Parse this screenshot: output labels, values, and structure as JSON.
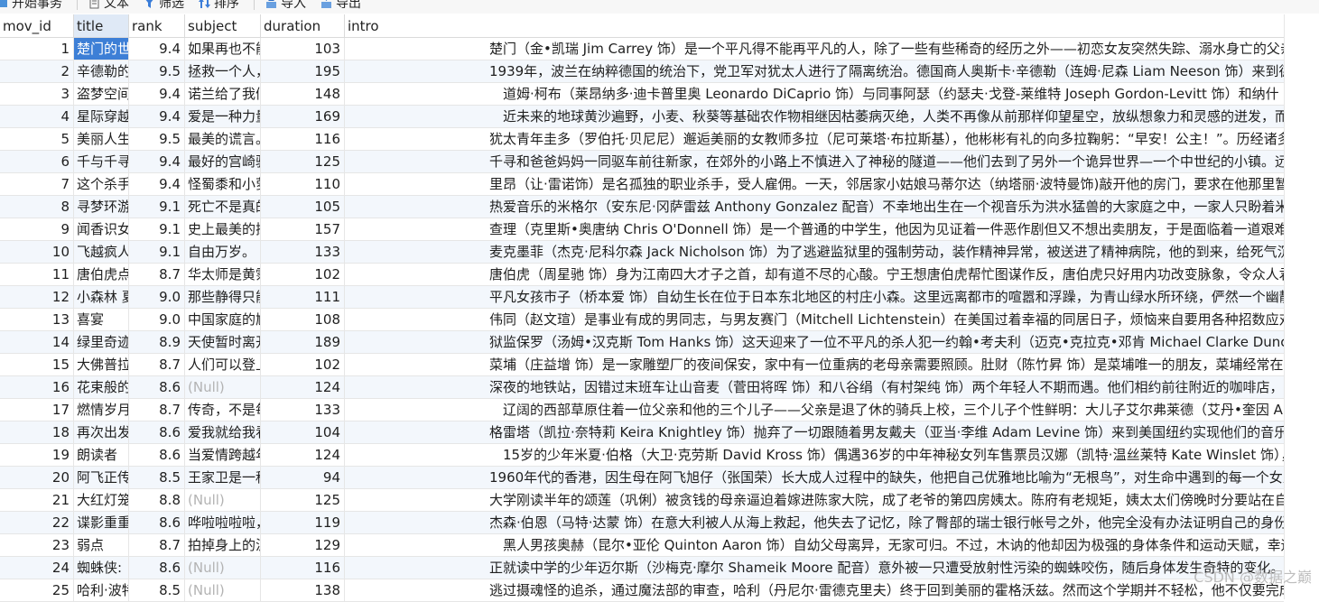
{
  "toolbar": {
    "items": [
      "开始事务",
      "文本",
      "筛选",
      "排序",
      "导入",
      "导出"
    ]
  },
  "columns": [
    "mov_id",
    "title",
    "rank",
    "subject",
    "duration",
    "intro"
  ],
  "null_text": "(Null)",
  "watermark": "CSDN @数据之巅",
  "rows": [
    {
      "id": "1",
      "title": "楚门的世",
      "rank": "9.4",
      "subject": "如果再也不能",
      "duration": "103",
      "intro": "楚门（金•凯瑞 Jim Carrey 饰）是一个平凡得不能再平凡的人，除了一些有些稀奇的经历之外——初恋女友突然失踪、溺水身亡的父亲"
    },
    {
      "id": "2",
      "title": "辛德勒的",
      "rank": "9.5",
      "subject": "拯救一个人，",
      "duration": "195",
      "intro": "1939年，波兰在纳粹德国的统治下，党卫军对犹太人进行了隔离统治。德国商人奥斯卡·辛德勒（连姆·尼森 Liam Neeson 饰）来到德"
    },
    {
      "id": "3",
      "title": "盗梦空间",
      "rank": "9.4",
      "subject": "诺兰给了我们",
      "duration": "148",
      "intro": "　道姆·柯布（莱昂纳多·迪卡普里奥 Leonardo DiCaprio 饰）与同事阿瑟（约瑟夫·戈登-莱维特 Joseph Gordon-Levitt 饰）和纳什（"
    },
    {
      "id": "4",
      "title": "星际穿越",
      "rank": "9.4",
      "subject": "爱是一种力量",
      "duration": "169",
      "intro": "　近未来的地球黄沙遍野，小麦、秋葵等基础农作物相继因枯萎病灭绝，人类不再像从前那样仰望星空，放纵想象力和灵感的迸发，而"
    },
    {
      "id": "5",
      "title": "美丽人生",
      "rank": "9.5",
      "subject": "最美的谎言。",
      "duration": "116",
      "intro": "犹太青年圭多（罗伯托·贝尼尼）邂逅美丽的女教师多拉（尼可莱塔·布拉斯基），他彬彬有礼的向多拉鞠躬：“早安！公主！”。历经诸多"
    },
    {
      "id": "6",
      "title": "千与千寻",
      "rank": "9.4",
      "subject": "最好的宫崎骏",
      "duration": "125",
      "intro": "千寻和爸爸妈妈一同驱车前往新家，在郊外的小路上不慎进入了神秘的隧道——他们去到了另外一个诡异世界—一个中世纪的小镇。远"
    },
    {
      "id": "7",
      "title": "这个杀手",
      "rank": "9.4",
      "subject": "怪蜀黍和小萝",
      "duration": "110",
      "intro": "里昂（让·雷诺饰）是名孤独的职业杀手，受人雇佣。一天，邻居家小姑娘马蒂尔达（纳塔丽·波特曼饰)敲开他的房门，要求在他那里暂"
    },
    {
      "id": "8",
      "title": "寻梦环游",
      "rank": "9.1",
      "subject": "死亡不是真的",
      "duration": "105",
      "intro": "热爱音乐的米格尔（安东尼·冈萨雷兹 Anthony Gonzalez 配音）不幸地出生在一个视音乐为洪水猛兽的大家庭之中，一家人只盼着米格"
    },
    {
      "id": "9",
      "title": "闻香识女",
      "rank": "9.1",
      "subject": "史上最美的探",
      "duration": "157",
      "intro": "查理（克里斯•奥唐纳 Chris O'Donnell 饰）是一个普通的中学生，他因为见证着一件恶作剧但又不想出卖朋友，于是面临着一道艰难"
    },
    {
      "id": "10",
      "title": "飞越疯人",
      "rank": "9.1",
      "subject": "自由万岁。",
      "duration": "133",
      "intro": "麦克墨菲（杰克·尼科尔森 Jack Nicholson 饰）为了逃避监狱里的强制劳动，装作精神异常，被送进了精神病院，他的到来，给死气沉"
    },
    {
      "id": "11",
      "title": "唐伯虎点",
      "rank": "8.7",
      "subject": "华太师是黄霑",
      "duration": "102",
      "intro": "唐伯虎（周星驰 饰）身为江南四大才子之首，却有道不尽的心酸。宁王想唐伯虎帮忙图谋作反，唐伯虎只好用内功改变脉象，令众人君"
    },
    {
      "id": "12",
      "title": "小森林 夏",
      "rank": "9.0",
      "subject": "那些静得只能",
      "duration": "111",
      "intro": "平凡女孩市子（桥本爱 饰）自幼生长在位于日本东北地区的村庄小森。这里远离都市的喧嚣和浮躁，为青山绿水所环绕，俨然一个幽静"
    },
    {
      "id": "13",
      "title": "喜宴",
      "rank": "9.0",
      "subject": "中国家庭的尴",
      "duration": "108",
      "intro": "伟同（赵文瑄）是事业有成的男同志，与男友赛门（Mitchell Lichtenstein）在美国过着幸福的同居日子，烦恼来自要用各种招数应对"
    },
    {
      "id": "14",
      "title": "绿里奇迹",
      "rank": "8.9",
      "subject": "天使暂时离开",
      "duration": "189",
      "intro": "狱监保罗（汤姆•汉克斯 Tom Hanks 饰）这天迎来了一位不平凡的杀人犯一约翰•考夫利（迈克•克拉克•邓肯 Michael Clarke Duncan"
    },
    {
      "id": "15",
      "title": "大佛普拉",
      "rank": "8.7",
      "subject": "人们可以登上",
      "duration": "102",
      "intro": "菜埔（庄益增 饰）是一家雕塑厂的夜间保安，家中有一位重病的老母亲需要照顾。肚财（陈竹昇 饰）是菜埔唯一的朋友，菜埔经常在值"
    },
    {
      "id": "16",
      "title": "花束般的",
      "rank": "8.6",
      "subject": null,
      "duration": "124",
      "intro": "深夜的地铁站，因错过末班车让山音麦（菅田将晖 饰）和八谷绢（有村架纯 饰）两个年轻人不期而遇。他们相约前往附近的咖啡店，并"
    },
    {
      "id": "17",
      "title": "燃情岁月",
      "rank": "8.7",
      "subject": "传奇，不是每",
      "duration": "133",
      "intro": "　辽阔的西部草原住着一位父亲和他的三个儿子——父亲是退了休的骑兵上校，三个儿子个性鲜明：大儿子艾尔弗莱德（艾丹•奎因 Ai"
    },
    {
      "id": "18",
      "title": "再次出发",
      "rank": "8.6",
      "subject": "爱我就给我看",
      "duration": "104",
      "intro": "格雷塔（凯拉·奈特莉 Keira Knightley 饰）抛弃了一切跟随着男友戴夫（亚当·李维 Adam Levine 饰）来到美国纽约实现他们的音乐梦"
    },
    {
      "id": "19",
      "title": "朗读者",
      "rank": "8.6",
      "subject": "当爱情跨越年",
      "duration": "124",
      "intro": "　15岁的少年米夏·伯格（大卫·克劳斯 David Kross 饰）偶遇36岁的中年神秘女列车售票员汉娜（凯特·温丝莱特 Kate Winslet 饰），"
    },
    {
      "id": "20",
      "title": "阿飞正传",
      "rank": "8.5",
      "subject": "王家卫是一种",
      "duration": "94",
      "intro": "1960年代的香港，因生母在阿飞旭仔（张国荣）长大成人过程中的缺失，他把自己优雅地比喻为“无根鸟”，对生命中遇到的每一个女人"
    },
    {
      "id": "21",
      "title": "大红灯笼",
      "rank": "8.8",
      "subject": null,
      "duration": "125",
      "intro": "大学刚读半年的颂莲（巩俐）被贪钱的母亲逼迫着嫁进陈家大院，成了老爷的第四房姨太。陈府有老规矩，姨太太们傍晚时分要站在自"
    },
    {
      "id": "22",
      "title": "谍影重重",
      "rank": "8.6",
      "subject": "哗啦啦啦啦，",
      "duration": "119",
      "intro": "杰森·伯恩（马特·达蒙 饰）在意大利被人从海上救起，他失去了记忆，除了臀部的瑞士银行帐号之外，他完全没有办法证明自己的身份"
    },
    {
      "id": "23",
      "title": "弱点",
      "rank": "8.7",
      "subject": "拍掉身上的泥",
      "duration": "129",
      "intro": "　黑人男孩奥赫（昆尔•亚伦 Quinton Aaron 饰）自幼父母离异，无家可归。不过，木讷的他却因为极强的身体条件和运动天赋，幸运"
    },
    {
      "id": "24",
      "title": "蜘蛛侠:",
      "rank": "8.6",
      "subject": null,
      "duration": "116",
      "intro": "正就读中学的少年迈尔斯（沙梅克·摩尔 Shameik Moore 配音）意外被一只遭受放射性污染的蜘蛛咬伤，随后身体发生奇特的变化。但"
    },
    {
      "id": "25",
      "title": "哈利·波特",
      "rank": "8.5",
      "subject": null,
      "duration": "138",
      "intro": "逃过摄魂怪的追杀，通过魔法部的审查，哈利（丹尼尔·雷德克里夫）终于回到美丽的霍格沃兹。然而这个学期并不轻松，他不仅要完成"
    }
  ]
}
